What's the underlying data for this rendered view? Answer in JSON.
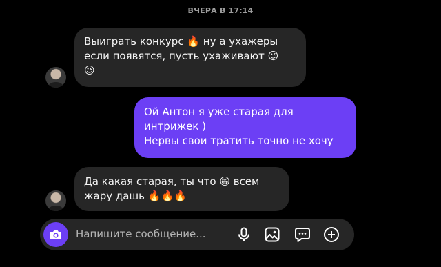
{
  "chat": {
    "date_separator": "ВЧЕРА В 17:14",
    "messages": [
      {
        "direction": "incoming",
        "lines": [
          "Выиграть конкурс 🔥 ну а ухажеры",
          "если появятся, пусть ухаживают 😉",
          "😉"
        ]
      },
      {
        "direction": "outgoing",
        "lines": [
          "Ой Антон я уже старая для",
          "интрижек )",
          "Нервы свои тратить точно не хочу"
        ]
      },
      {
        "direction": "incoming",
        "lines": [
          "Да какая старая, ты что 😁 всем",
          "жару дашь 🔥🔥🔥"
        ]
      }
    ]
  },
  "composer": {
    "placeholder": "Напишите сообщение...",
    "icons": [
      "camera-icon",
      "microphone-icon",
      "gallery-icon",
      "sticker-icon",
      "plus-icon"
    ],
    "accent_color": "#6c3ff5"
  },
  "colors": {
    "background": "#000000",
    "incoming_bubble": "#262626",
    "outgoing_bubble": "#6c3ff5"
  }
}
